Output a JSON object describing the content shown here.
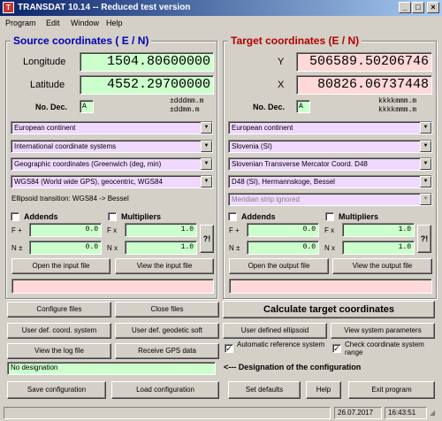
{
  "window": {
    "title": "TRANSDAT 10.14 -- Reduced test version",
    "icon": "app-icon"
  },
  "menu": [
    "Program",
    "Edit",
    "Window",
    "Help"
  ],
  "source": {
    "title": "Source coordinates ( E / N)",
    "longitude_label": "Longitude",
    "longitude_value": "1504.80600000",
    "latitude_label": "Latitude",
    "latitude_value": "4552.29700000",
    "nodec_label": "No. Dec.",
    "nodec_value": "A",
    "format1": "±dddmm.m",
    "format2": "±ddmm.m",
    "continent": "European continent",
    "system_type": "International coordinate systems",
    "coord_kind": "Geographic coordinates (Greenwich (deg, min)",
    "datum": "WGS84 (World wide GPS), geocentric, WGS84",
    "ellipsoid_transition": "Ellipsoid transition: WGS84 -> Bessel",
    "addends_label": "Addends",
    "multipliers_label": "Multipliers",
    "f_plus": "F +",
    "n_plus": "N ±",
    "f_mult": "F x",
    "n_mult": "N x",
    "f_add_value": "0.0",
    "n_add_value": "0.0",
    "f_mul_value": "1.0",
    "n_mul_value": "1.0",
    "help_btn": "?!",
    "open_input": "Open the input file",
    "view_input": "View the input file"
  },
  "target": {
    "title": "Target coordinates (E / N)",
    "y_label": "Y",
    "y_value": "506589.50206746",
    "x_label": "X",
    "x_value": "80826.06737448",
    "nodec_label": "No. Dec.",
    "nodec_value": "A",
    "format1": "kkkkmmm.m",
    "format2": "kkkkmmm.m",
    "continent": "European continent",
    "country": "Slovenia (SI)",
    "projection": "Slovenian Transverse Mercator Coord. D48",
    "datum": "D48 (SI), Hermannskoge, Bessel",
    "strip": "Meridian strip ignored",
    "addends_label": "Addends",
    "multipliers_label": "Multipliers",
    "f_plus": "F +",
    "n_plus": "N ±",
    "f_mult": "F x",
    "n_mult": "N x",
    "f_add_value": "0.0",
    "n_add_value": "0.0",
    "f_mul_value": "1.0",
    "n_mul_value": "1.0",
    "help_btn": "?!",
    "open_output": "Open the output file",
    "view_output": "View the output file"
  },
  "buttons": {
    "configure_files": "Configure files",
    "close_files": "Close files",
    "calculate": "Calculate target coordinates",
    "user_def_coord": "User def. coord. system",
    "user_def_geod": "User def. geodetic soft",
    "user_def_ellipsoid": "User defined ellipsoid",
    "view_sys_params": "View system parameters",
    "view_log": "View the log file",
    "receive_gps": "Receive GPS data",
    "auto_ref": "Automatic reference system",
    "check_range": "Check coordinate system range",
    "save_config": "Save configuration",
    "load_config": "Load configuration",
    "set_defaults": "Set defaults",
    "help": "Help",
    "exit": "Exit program"
  },
  "designation": {
    "value": "No designation",
    "label": "<--- Designation of the configuration"
  },
  "status": {
    "date": "26.07.2017",
    "time": "16:43:51"
  }
}
